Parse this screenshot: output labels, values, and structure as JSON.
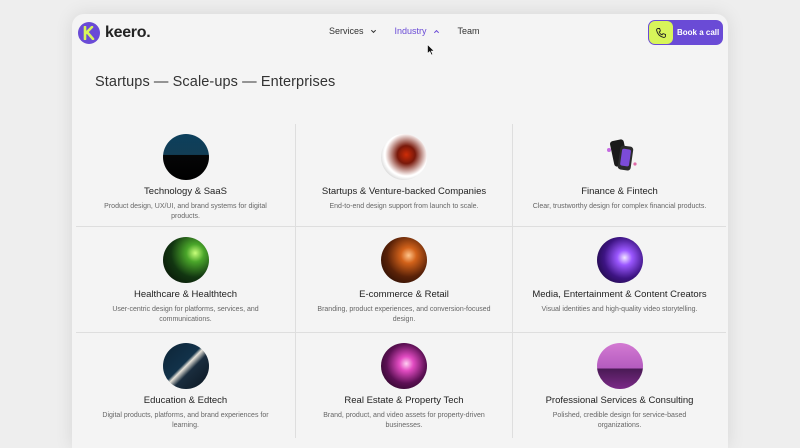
{
  "brand": {
    "name": "keero."
  },
  "nav": {
    "items": [
      {
        "label": "Services",
        "active": false,
        "has_chevron": true
      },
      {
        "label": "Industry",
        "active": true,
        "has_chevron": true
      },
      {
        "label": "Team",
        "active": false,
        "has_chevron": false
      }
    ],
    "cta_label": "Book a call"
  },
  "section": {
    "heading": "Startups — Scale-ups — Enterprises"
  },
  "industries": [
    {
      "title": "Technology & SaaS",
      "desc": "Product design, UX/UI, and brand systems for digital products."
    },
    {
      "title": "Startups & Venture-backed Companies",
      "desc": "End-to-end design support from launch to scale."
    },
    {
      "title": "Finance & Fintech",
      "desc": "Clear, trustworthy design for complex financial products."
    },
    {
      "title": "Healthcare & Healthtech",
      "desc": "User-centric design for platforms, services, and communications."
    },
    {
      "title": "E-commerce & Retail",
      "desc": "Branding, product experiences, and conversion-focused design."
    },
    {
      "title": "Media, Entertainment & Content Creators",
      "desc": "Visual identities and high-quality video storytelling."
    },
    {
      "title": "Education & Edtech",
      "desc": "Digital products, platforms, and brand experiences for learning."
    },
    {
      "title": "Real Estate & Property Tech",
      "desc": "Brand, product, and video assets for property-driven businesses."
    },
    {
      "title": "Professional Services & Consulting",
      "desc": "Polished, credible design for service-based organizations."
    }
  ],
  "colors": {
    "accent": "#6a4bd6",
    "cta_phone": "#d8f55a",
    "background": "#f4f4f4"
  },
  "icons": {
    "logo": "k-logo-icon",
    "nav_chevron": "chevron-icon",
    "cta": "phone-icon",
    "cursor": "mouse-cursor-icon"
  }
}
